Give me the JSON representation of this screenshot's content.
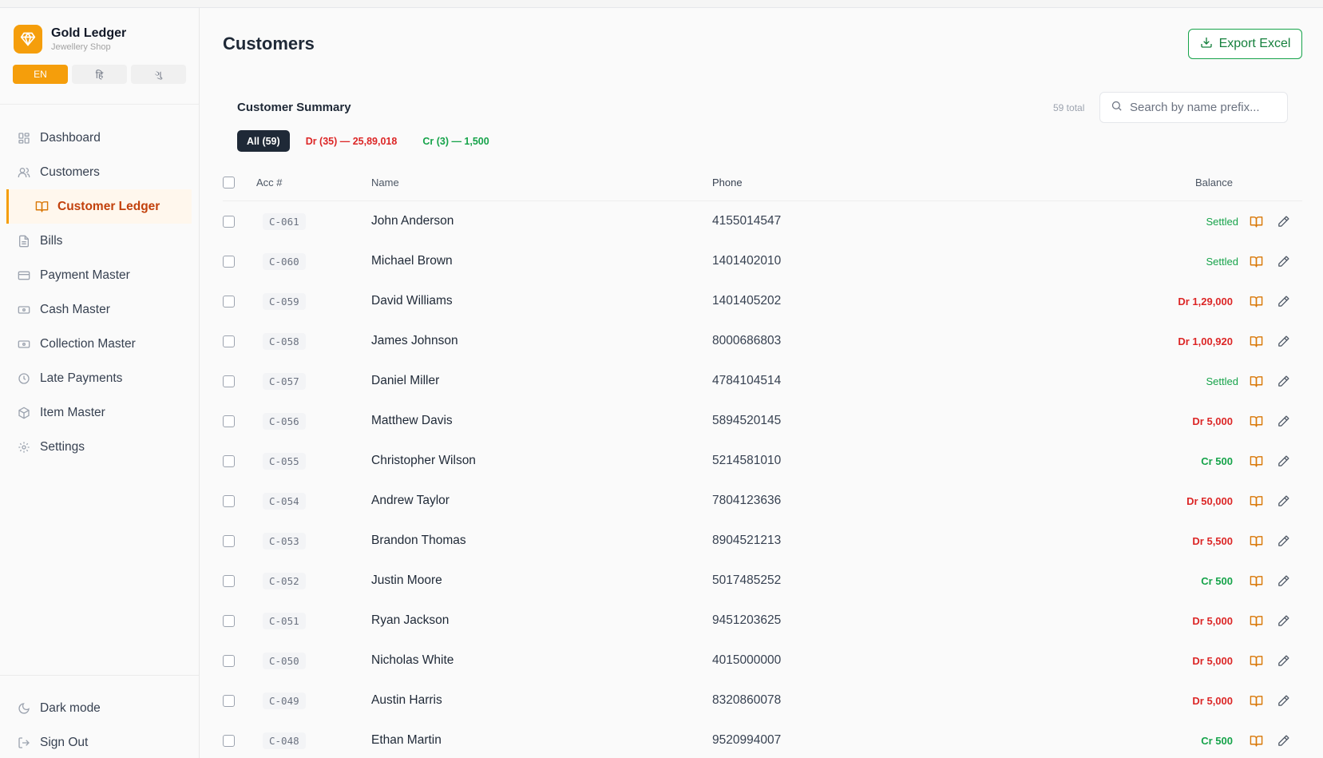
{
  "brand": {
    "name": "Gold Ledger",
    "subtitle": "Jewellery Shop",
    "icon": "diamond-icon",
    "accent": "#f59e0b"
  },
  "languages": [
    {
      "label": "EN",
      "active": true
    },
    {
      "label": "हि",
      "active": false
    },
    {
      "label": "ગુ",
      "active": false
    }
  ],
  "nav": {
    "items": [
      {
        "label": "Dashboard",
        "icon": "grid-icon"
      },
      {
        "label": "Customers",
        "icon": "users-icon"
      },
      {
        "label": "Customer Ledger",
        "icon": "book-icon",
        "active": true
      },
      {
        "label": "Bills",
        "icon": "document-icon"
      },
      {
        "label": "Payment Master",
        "icon": "card-icon"
      },
      {
        "label": "Cash Master",
        "icon": "cash-icon"
      },
      {
        "label": "Collection Master",
        "icon": "wallet-icon"
      },
      {
        "label": "Late Payments",
        "icon": "clock-icon"
      },
      {
        "label": "Item Master",
        "icon": "box-icon"
      },
      {
        "label": "Settings",
        "icon": "gear-icon"
      }
    ],
    "bottom": [
      {
        "label": "Dark mode",
        "icon": "moon-icon"
      },
      {
        "label": "Sign Out",
        "icon": "logout-icon"
      }
    ]
  },
  "page": {
    "title": "Customers",
    "export_label": "Export Excel"
  },
  "summary": {
    "title": "Customer Summary",
    "total": "59 total",
    "search_placeholder": "Search by name prefix...",
    "filters": [
      {
        "label": "All (59)",
        "kind": "all"
      },
      {
        "label": "Dr (35) — 25,89,018",
        "kind": "dr"
      },
      {
        "label": "Cr (3) — 1,500",
        "kind": "cr"
      }
    ]
  },
  "table": {
    "headers": {
      "acc": "Acc #",
      "name": "Name",
      "phone": "Phone",
      "balance": "Balance"
    },
    "rows": [
      {
        "acc": "C-061",
        "name": "John Anderson",
        "phone": "4155014547",
        "balance": "Settled",
        "type": "settled"
      },
      {
        "acc": "C-060",
        "name": "Michael Brown",
        "phone": "1401402010",
        "balance": "Settled",
        "type": "settled"
      },
      {
        "acc": "C-059",
        "name": "David Williams",
        "phone": "1401405202",
        "balance": "Dr 1,29,000",
        "type": "dr"
      },
      {
        "acc": "C-058",
        "name": "James Johnson",
        "phone": "8000686803",
        "balance": "Dr 1,00,920",
        "type": "dr"
      },
      {
        "acc": "C-057",
        "name": "Daniel Miller",
        "phone": "4784104514",
        "balance": "Settled",
        "type": "settled"
      },
      {
        "acc": "C-056",
        "name": "Matthew Davis",
        "phone": "5894520145",
        "balance": "Dr 5,000",
        "type": "dr"
      },
      {
        "acc": "C-055",
        "name": "Christopher Wilson",
        "phone": "5214581010",
        "balance": "Cr 500",
        "type": "cr"
      },
      {
        "acc": "C-054",
        "name": "Andrew Taylor",
        "phone": "7804123636",
        "balance": "Dr 50,000",
        "type": "dr"
      },
      {
        "acc": "C-053",
        "name": "Brandon Thomas",
        "phone": "8904521213",
        "balance": "Dr 5,500",
        "type": "dr"
      },
      {
        "acc": "C-052",
        "name": "Justin Moore",
        "phone": "5017485252",
        "balance": "Cr 500",
        "type": "cr"
      },
      {
        "acc": "C-051",
        "name": "Ryan Jackson",
        "phone": "9451203625",
        "balance": "Dr 5,000",
        "type": "dr"
      },
      {
        "acc": "C-050",
        "name": "Nicholas White",
        "phone": "4015000000",
        "balance": "Dr 5,000",
        "type": "dr"
      },
      {
        "acc": "C-049",
        "name": "Austin Harris",
        "phone": "8320860078",
        "balance": "Dr 5,000",
        "type": "dr"
      },
      {
        "acc": "C-048",
        "name": "Ethan Martin",
        "phone": "9520994007",
        "balance": "Cr 500",
        "type": "cr"
      }
    ]
  },
  "colors": {
    "accent": "#f59e0b",
    "debit": "#dc2626",
    "credit": "#16a34a",
    "export": "#16a34a"
  }
}
